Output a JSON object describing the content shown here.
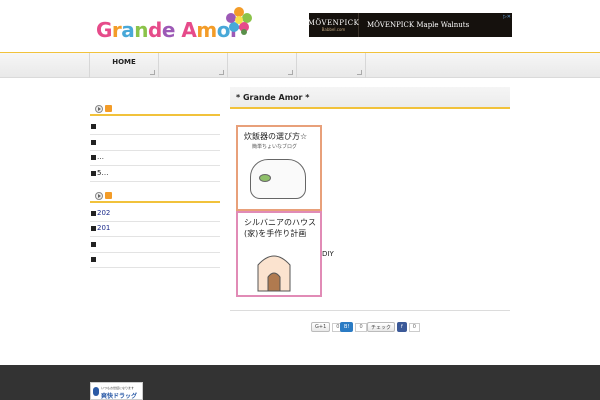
{
  "header": {
    "logo_letters": [
      "G",
      "r",
      "a",
      "n",
      "d",
      "e",
      " ",
      "A",
      "m",
      "o",
      "r"
    ],
    "logo_colors": [
      "#e64b8a",
      "#f39c28",
      "#48a8d8",
      "#8bc34a",
      "#e64b8a",
      "#9c59b6",
      "#ffffff",
      "#e64b8a",
      "#f39c28",
      "#48a8d8",
      "#9c59b6"
    ]
  },
  "ad": {
    "brand": "MÖVENPICK",
    "brand_sub": "Babbel.com",
    "title": "MÖVENPICK Maple Walnuts"
  },
  "nav": {
    "home_label": "HOME"
  },
  "sidebar": {
    "rows_a": [
      "",
      "",
      "…",
      "5…"
    ],
    "rows_b": [
      "202",
      "201",
      "",
      ""
    ]
  },
  "post": {
    "title": "* Grande Amor *",
    "thumb1_caption": "炊飯器の選び方☆",
    "thumb1_sub": "簡単ちょいなブログ",
    "thumb2_caption": "シルバニアのハウス(家)を手作り計画",
    "diy_label": "DIY"
  },
  "share": {
    "gplus": "G+1",
    "gplus_count": "0",
    "hatena": "B!",
    "hatena_count": "0",
    "check": "チェック",
    "fb": "f",
    "fb_count": "0"
  },
  "footer": {
    "banner_top": "いつもお世話になります",
    "banner_name": "爽快ドラッグ"
  }
}
